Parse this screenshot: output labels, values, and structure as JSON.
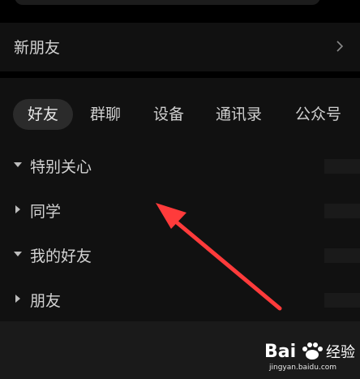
{
  "new_friends": {
    "label": "新朋友"
  },
  "tabs": [
    {
      "label": "好友",
      "active": true
    },
    {
      "label": "群聊",
      "active": false
    },
    {
      "label": "设备",
      "active": false
    },
    {
      "label": "通讯录",
      "active": false
    },
    {
      "label": "公众号",
      "active": false
    }
  ],
  "groups": [
    {
      "label": "特别关心",
      "expanded": true,
      "icon": "caret-down-icon"
    },
    {
      "label": "同学",
      "expanded": false,
      "icon": "caret-right-icon"
    },
    {
      "label": "我的好友",
      "expanded": true,
      "icon": "caret-down-icon"
    },
    {
      "label": "朋友",
      "expanded": false,
      "icon": "caret-right-icon"
    }
  ],
  "watermark": {
    "brand": "Baidu经验",
    "url": "jingyan.baidu.com"
  },
  "colors": {
    "background": "#000000",
    "panel": "#111111",
    "active_tab": "#2b2b2b",
    "annotation_arrow": "#ff3b3b"
  }
}
